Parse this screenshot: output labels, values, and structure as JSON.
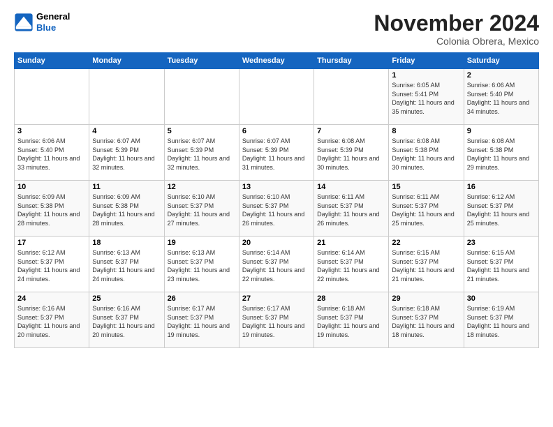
{
  "logo": {
    "line1": "General",
    "line2": "Blue"
  },
  "title": "November 2024",
  "subtitle": "Colonia Obrera, Mexico",
  "days_of_week": [
    "Sunday",
    "Monday",
    "Tuesday",
    "Wednesday",
    "Thursday",
    "Friday",
    "Saturday"
  ],
  "weeks": [
    [
      {
        "day": "",
        "detail": ""
      },
      {
        "day": "",
        "detail": ""
      },
      {
        "day": "",
        "detail": ""
      },
      {
        "day": "",
        "detail": ""
      },
      {
        "day": "",
        "detail": ""
      },
      {
        "day": "1",
        "detail": "Sunrise: 6:05 AM\nSunset: 5:41 PM\nDaylight: 11 hours\nand 35 minutes."
      },
      {
        "day": "2",
        "detail": "Sunrise: 6:06 AM\nSunset: 5:40 PM\nDaylight: 11 hours\nand 34 minutes."
      }
    ],
    [
      {
        "day": "3",
        "detail": "Sunrise: 6:06 AM\nSunset: 5:40 PM\nDaylight: 11 hours\nand 33 minutes."
      },
      {
        "day": "4",
        "detail": "Sunrise: 6:07 AM\nSunset: 5:39 PM\nDaylight: 11 hours\nand 32 minutes."
      },
      {
        "day": "5",
        "detail": "Sunrise: 6:07 AM\nSunset: 5:39 PM\nDaylight: 11 hours\nand 32 minutes."
      },
      {
        "day": "6",
        "detail": "Sunrise: 6:07 AM\nSunset: 5:39 PM\nDaylight: 11 hours\nand 31 minutes."
      },
      {
        "day": "7",
        "detail": "Sunrise: 6:08 AM\nSunset: 5:39 PM\nDaylight: 11 hours\nand 30 minutes."
      },
      {
        "day": "8",
        "detail": "Sunrise: 6:08 AM\nSunset: 5:38 PM\nDaylight: 11 hours\nand 30 minutes."
      },
      {
        "day": "9",
        "detail": "Sunrise: 6:08 AM\nSunset: 5:38 PM\nDaylight: 11 hours\nand 29 minutes."
      }
    ],
    [
      {
        "day": "10",
        "detail": "Sunrise: 6:09 AM\nSunset: 5:38 PM\nDaylight: 11 hours\nand 28 minutes."
      },
      {
        "day": "11",
        "detail": "Sunrise: 6:09 AM\nSunset: 5:38 PM\nDaylight: 11 hours\nand 28 minutes."
      },
      {
        "day": "12",
        "detail": "Sunrise: 6:10 AM\nSunset: 5:37 PM\nDaylight: 11 hours\nand 27 minutes."
      },
      {
        "day": "13",
        "detail": "Sunrise: 6:10 AM\nSunset: 5:37 PM\nDaylight: 11 hours\nand 26 minutes."
      },
      {
        "day": "14",
        "detail": "Sunrise: 6:11 AM\nSunset: 5:37 PM\nDaylight: 11 hours\nand 26 minutes."
      },
      {
        "day": "15",
        "detail": "Sunrise: 6:11 AM\nSunset: 5:37 PM\nDaylight: 11 hours\nand 25 minutes."
      },
      {
        "day": "16",
        "detail": "Sunrise: 6:12 AM\nSunset: 5:37 PM\nDaylight: 11 hours\nand 25 minutes."
      }
    ],
    [
      {
        "day": "17",
        "detail": "Sunrise: 6:12 AM\nSunset: 5:37 PM\nDaylight: 11 hours\nand 24 minutes."
      },
      {
        "day": "18",
        "detail": "Sunrise: 6:13 AM\nSunset: 5:37 PM\nDaylight: 11 hours\nand 24 minutes."
      },
      {
        "day": "19",
        "detail": "Sunrise: 6:13 AM\nSunset: 5:37 PM\nDaylight: 11 hours\nand 23 minutes."
      },
      {
        "day": "20",
        "detail": "Sunrise: 6:14 AM\nSunset: 5:37 PM\nDaylight: 11 hours\nand 22 minutes."
      },
      {
        "day": "21",
        "detail": "Sunrise: 6:14 AM\nSunset: 5:37 PM\nDaylight: 11 hours\nand 22 minutes."
      },
      {
        "day": "22",
        "detail": "Sunrise: 6:15 AM\nSunset: 5:37 PM\nDaylight: 11 hours\nand 21 minutes."
      },
      {
        "day": "23",
        "detail": "Sunrise: 6:15 AM\nSunset: 5:37 PM\nDaylight: 11 hours\nand 21 minutes."
      }
    ],
    [
      {
        "day": "24",
        "detail": "Sunrise: 6:16 AM\nSunset: 5:37 PM\nDaylight: 11 hours\nand 20 minutes."
      },
      {
        "day": "25",
        "detail": "Sunrise: 6:16 AM\nSunset: 5:37 PM\nDaylight: 11 hours\nand 20 minutes."
      },
      {
        "day": "26",
        "detail": "Sunrise: 6:17 AM\nSunset: 5:37 PM\nDaylight: 11 hours\nand 19 minutes."
      },
      {
        "day": "27",
        "detail": "Sunrise: 6:17 AM\nSunset: 5:37 PM\nDaylight: 11 hours\nand 19 minutes."
      },
      {
        "day": "28",
        "detail": "Sunrise: 6:18 AM\nSunset: 5:37 PM\nDaylight: 11 hours\nand 19 minutes."
      },
      {
        "day": "29",
        "detail": "Sunrise: 6:18 AM\nSunset: 5:37 PM\nDaylight: 11 hours\nand 18 minutes."
      },
      {
        "day": "30",
        "detail": "Sunrise: 6:19 AM\nSunset: 5:37 PM\nDaylight: 11 hours\nand 18 minutes."
      }
    ]
  ]
}
